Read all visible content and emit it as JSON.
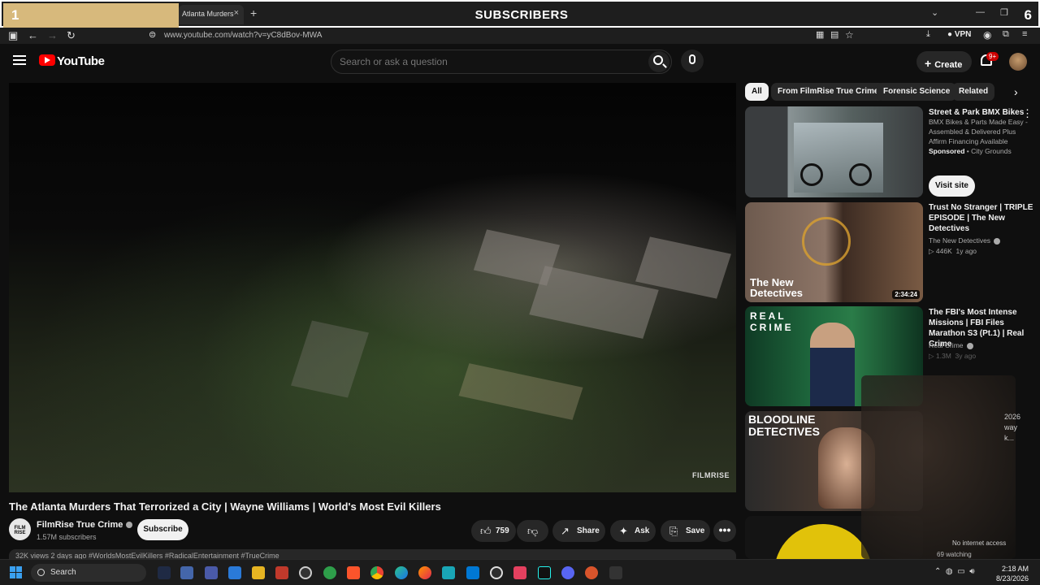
{
  "overlay": {
    "left_number": "1",
    "banner": "SUBSCRIBERS",
    "right_number": "6"
  },
  "browser": {
    "tab_title": "Atlanta Murders",
    "tab_close": "×",
    "new_tab": "+",
    "url": "www.youtube.com/watch?v=yC8dBov-MWA",
    "vpn_label": "VPN",
    "window_controls": [
      "⌄",
      "—",
      "❐",
      "✕"
    ]
  },
  "yt_header": {
    "logo_text": "YouTube",
    "search_placeholder": "Search or ask a question",
    "create_label": "Create",
    "notification_badge": "9+"
  },
  "video": {
    "watermark": "FILMRISE",
    "title": "The Atlanta Murders That Terrorized a City | Wayne Williams | World's Most Evil Killers",
    "channel_name": "FilmRise True Crime",
    "channel_avatar_text": "FILM RISE",
    "subscribers": "1.57M subscribers",
    "subscribe_label": "Subscribe",
    "likes": "759",
    "share_label": "Share",
    "ask_label": "Ask",
    "save_label": "Save",
    "more_label": "•••",
    "description_preview": "32K views 2 days ago #WorldsMostEvilKillers #RadicalEntertainment #TrueCrime"
  },
  "chips": [
    "All",
    "From FilmRise True Crime",
    "Forensic Science",
    "Related"
  ],
  "sidebar": {
    "ad": {
      "title": "Street & Park BMX Bikes",
      "description": "BMX Bikes & Parts Made Easy - Assembled & Delivered Plus Affirm Financing Available",
      "sponsored": "Sponsored",
      "advertiser": "City Grounds",
      "cta": "Visit site"
    },
    "items": [
      {
        "title": "Trust No Stranger | TRIPLE EPISODE | The New Detectives",
        "channel": "The New Detectives",
        "views": "446K",
        "age": "1y ago",
        "duration": "2:34:24",
        "thumb_text": "The New Detectives"
      },
      {
        "title": "The FBI's Most Intense Missions | FBI Files Marathon S3 (Pt.1) | Real Crime",
        "channel": "Real Crime",
        "views": "1.3M",
        "age": "3y ago",
        "thumb_text": "REAL CRIME"
      },
      {
        "title": "",
        "channel": "",
        "thumb_text": "BLOODLINE DETECTIVES"
      }
    ],
    "partial_text": [
      "2026",
      "way",
      "k..."
    ]
  },
  "webcam": {
    "no_internet": "No internet access",
    "watching": "69 watching"
  },
  "taskbar": {
    "search_label": "Search",
    "time": "2:18 AM",
    "date": "8/23/2026"
  },
  "colors": {
    "yt_red": "#ff0000",
    "bg": "#0f0f0f",
    "chip_bg": "#272727",
    "overlay_gold": "#d7b97c"
  }
}
